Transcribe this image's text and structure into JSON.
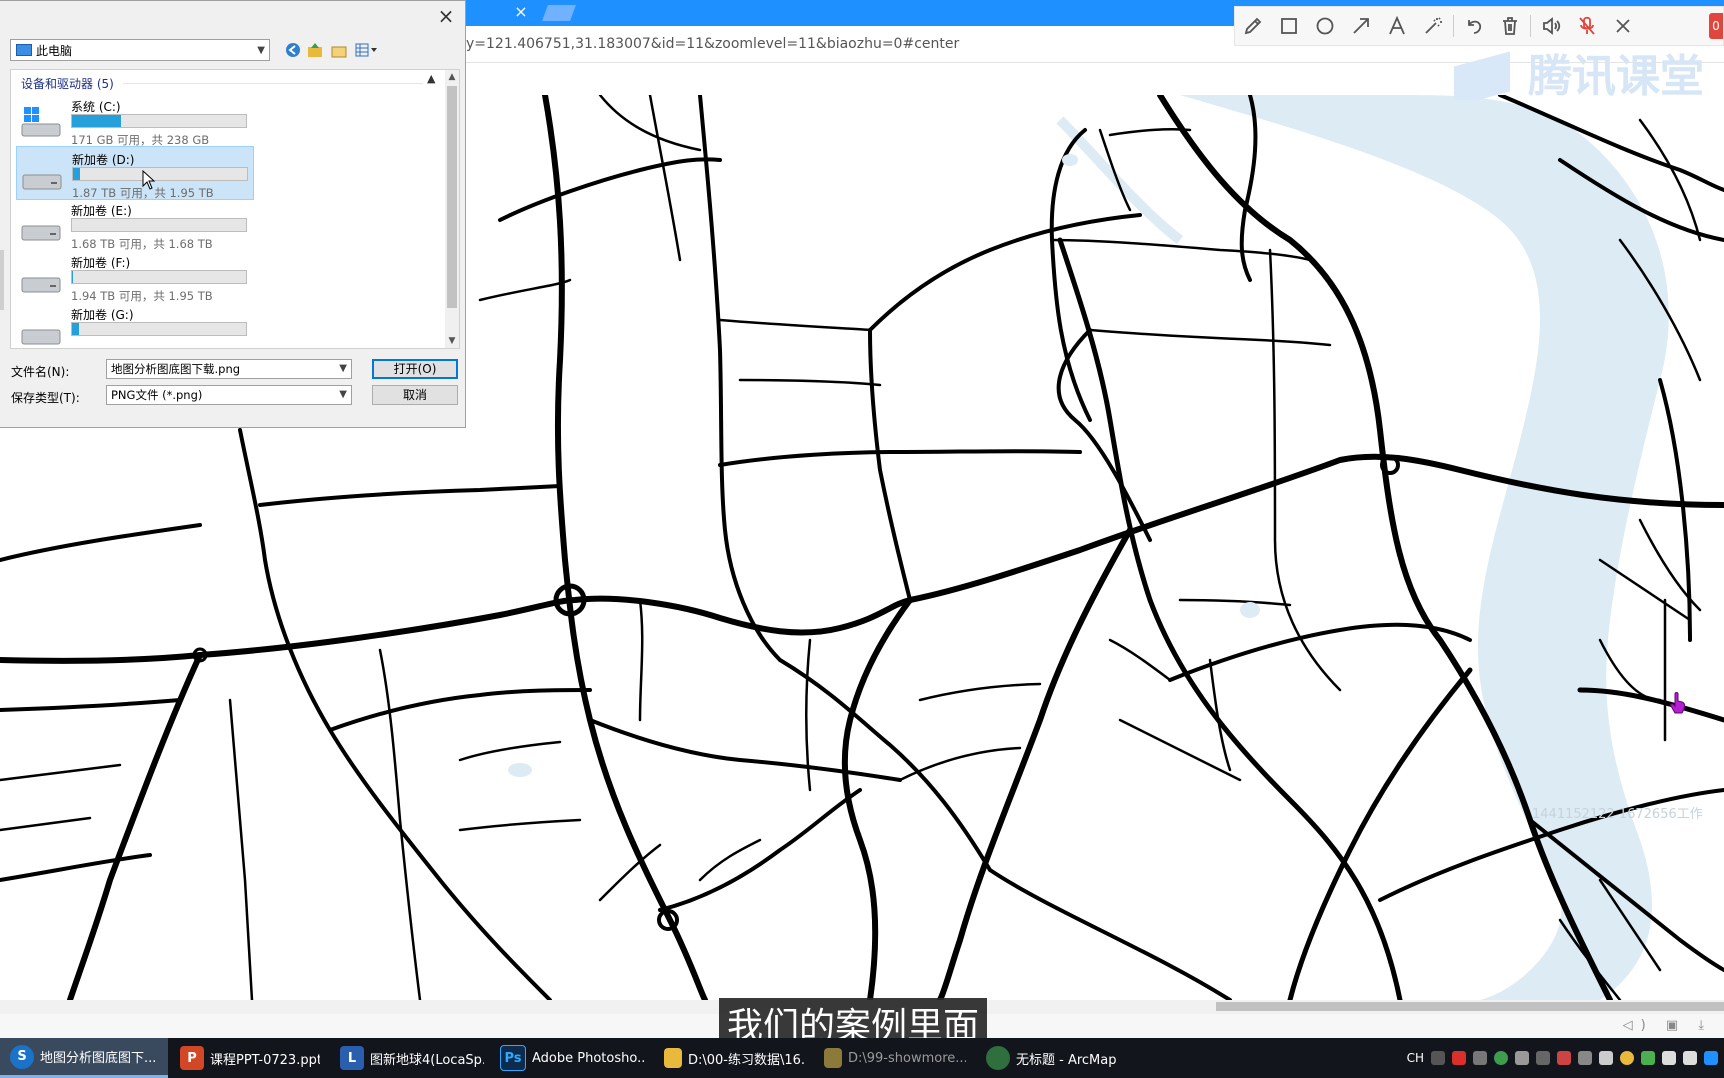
{
  "browser": {
    "address_text": "y=121.406751,31.183007&id=11&zoomlevel=11&biaozhu=0#center",
    "tab_close": "×",
    "watermark": "腾讯课堂",
    "side_watermark": "1441152122 1672656工作"
  },
  "toolbar": {
    "tools": [
      "pencil-icon",
      "rectangle-icon",
      "circle-icon",
      "arrow-icon",
      "text-icon",
      "magic-wand-icon",
      "undo-icon",
      "delete-icon",
      "speaker-icon",
      "mic-muted-icon",
      "close-icon"
    ],
    "counter": "0"
  },
  "dialog": {
    "location": "此电脑",
    "close": "×",
    "group_label": "设备和驱动器 (5)",
    "drives": [
      {
        "name": "系统 (C:)",
        "info": "171 GB 可用，共 238 GB",
        "used_fraction": 0.28
      },
      {
        "name": "新加卷 (D:)",
        "info": "1.87 TB 可用，共 1.95 TB",
        "used_fraction": 0.04
      },
      {
        "name": "新加卷 (E:)",
        "info": "1.68 TB 可用，共 1.68 TB",
        "used_fraction": 0.0
      },
      {
        "name": "新加卷 (F:)",
        "info": "1.94 TB 可用，共 1.95 TB",
        "used_fraction": 0.005
      },
      {
        "name": "新加卷 (G:)",
        "info": "",
        "used_fraction": 0.04
      }
    ],
    "filename_label": "文件名(N):",
    "filename_value": "地图分析图底图下载.png",
    "filetype_label": "保存类型(T):",
    "filetype_value": "PNG文件 (*.png)",
    "open_button": "打开(O)",
    "cancel_button": "取消"
  },
  "subtitle": "我们的案例里面",
  "taskbar": {
    "items": [
      {
        "label": "地图分析图底图下...",
        "icon_color": "#1a73c8",
        "icon_text": "S",
        "active": true
      },
      {
        "label": "课程PPT-0723.ppt...",
        "icon_color": "#d24726",
        "icon_text": "P",
        "active": false
      },
      {
        "label": "图新地球4(LocaSp...",
        "icon_color": "#2a5fb0",
        "icon_text": "L",
        "active": false
      },
      {
        "label": "Adobe Photosho...",
        "icon_color": "#0d2c4d",
        "icon_text": "Ps",
        "active": false
      },
      {
        "label": "D:\\00-练习数据\\16...",
        "icon_color": "#e8b93a",
        "icon_text": "",
        "active": false
      },
      {
        "label": "D:\\99-showmore...",
        "icon_color": "#e8b93a",
        "icon_text": "",
        "active": false,
        "dim": true
      },
      {
        "label": "无标题 - ArcMap",
        "icon_color": "#2f6f3e",
        "icon_text": "",
        "active": false
      }
    ],
    "tray_lang": "CH"
  },
  "colors": {
    "tab_bar": "#1e90ff",
    "river": "#dcebf4",
    "road": "#000000",
    "selection": "#cce4f7",
    "drive_fill": "#26a0da"
  }
}
